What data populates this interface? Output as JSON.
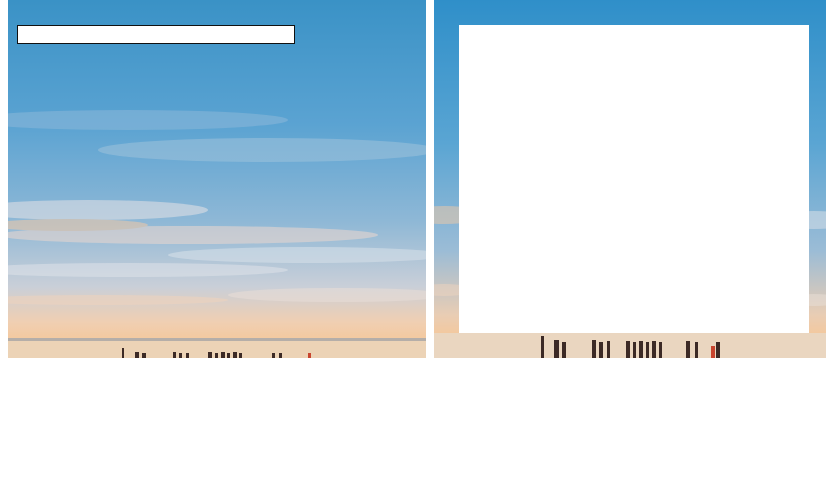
{
  "image": {
    "subject": "seascape-at-dusk",
    "colors": {
      "sky_top": "#3a92c6",
      "sky_mid": "#6faed6",
      "cloud_light": "#d9e2ea",
      "cloud_warm": "#f2c9a6",
      "horizon_glow": "#f4c89c",
      "water": "#ecd3b6",
      "posts": "#3c2a26",
      "posts_red": "#c8452f"
    }
  },
  "left_panel": {
    "text_box": {
      "value": ""
    }
  },
  "right_panel": {
    "mask": {
      "color": "#ffffff"
    }
  }
}
